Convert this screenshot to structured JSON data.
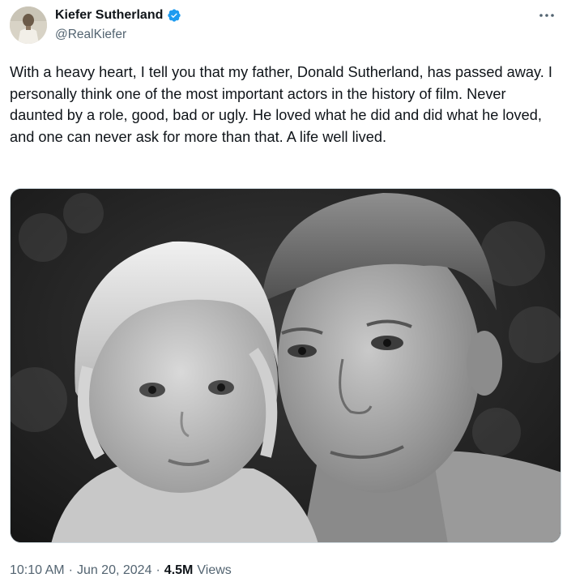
{
  "author": {
    "display_name": "Kiefer Sutherland",
    "handle": "@RealKiefer",
    "verified": true,
    "verified_color": "#1d9bf0"
  },
  "tweet": {
    "text": "With a heavy heart, I tell you that my father, Donald Sutherland, has passed away. I personally think one of the most important actors in the history of film. Never daunted by a role, good, bad or ugly. He loved what he did and did what he loved, and one can never ask for more than that. A life well lived."
  },
  "media": {
    "type": "black-and-white photo"
  },
  "meta": {
    "time": "10:10 AM",
    "separator": "·",
    "date": "Jun 20, 2024",
    "views_count": "4.5M",
    "views_label": "Views"
  }
}
